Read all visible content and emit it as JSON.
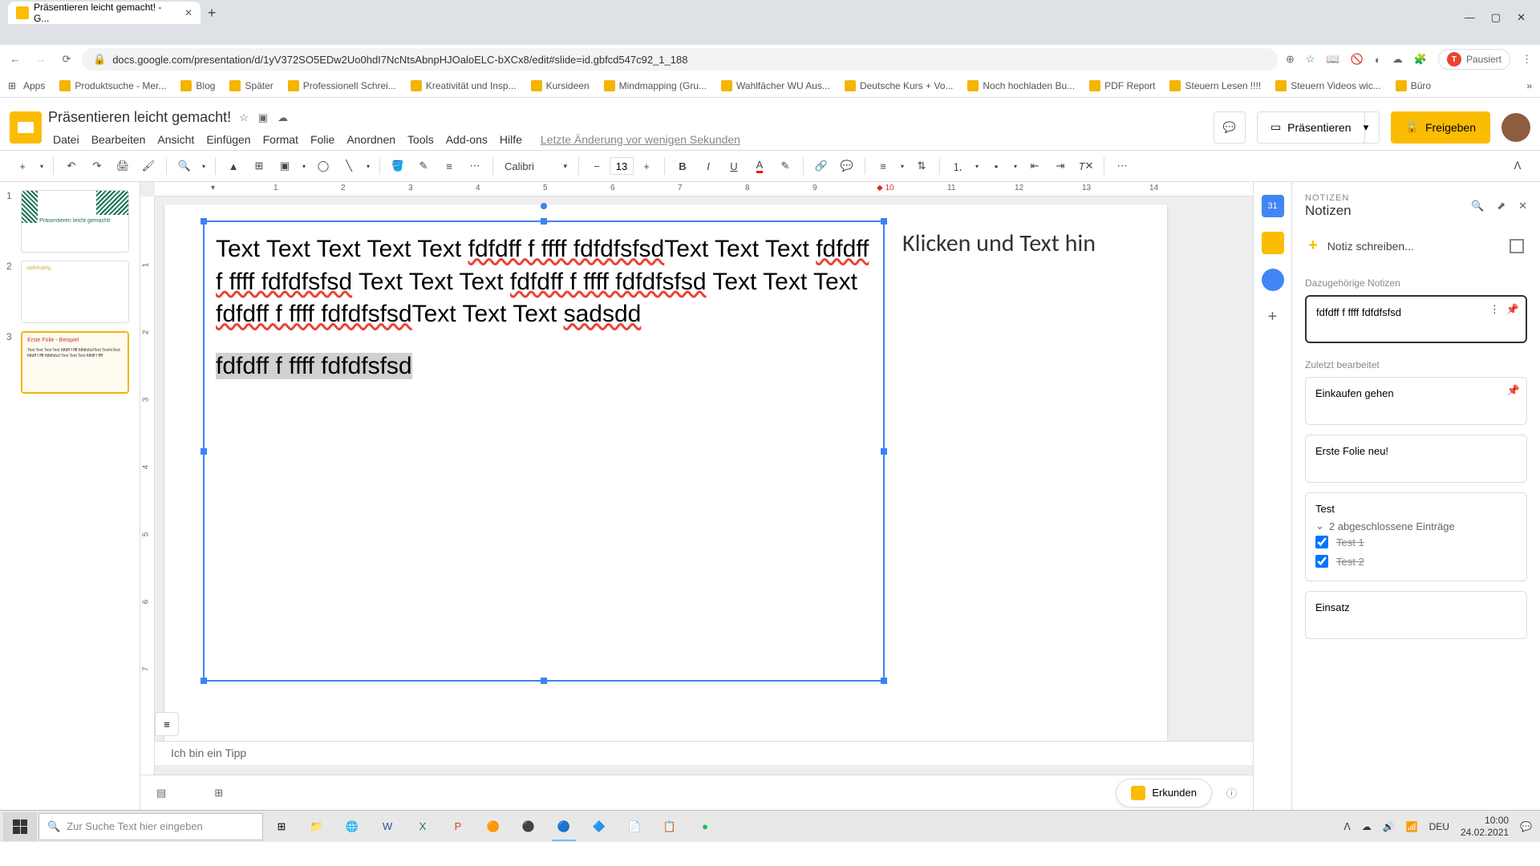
{
  "browser": {
    "tab_title": "Präsentieren leicht gemacht! - G...",
    "url": "docs.google.com/presentation/d/1yV372SO5EDw2Uo0hdI7NcNtsAbnpHJOaloELC-bXCx8/edit#slide=id.gbfcd547c92_1_188",
    "profile_label": "Pausiert"
  },
  "bookmarks": [
    "Apps",
    "Produktsuche - Mer...",
    "Blog",
    "Später",
    "Professionell Schrei...",
    "Kreativität und Insp...",
    "Kursideen",
    "Mindmapping (Gru...",
    "Wahlfächer WU Aus...",
    "Deutsche Kurs + Vo...",
    "Noch hochladen Bu...",
    "PDF Report",
    "Steuern Lesen !!!!",
    "Steuern Videos wic...",
    "Büro"
  ],
  "doc": {
    "title": "Präsentieren leicht gemacht!",
    "menus": [
      "Datei",
      "Bearbeiten",
      "Ansicht",
      "Einfügen",
      "Format",
      "Folie",
      "Anordnen",
      "Tools",
      "Add-ons",
      "Hilfe"
    ],
    "last_edit": "Letzte Änderung vor wenigen Sekunden",
    "present": "Präsentieren",
    "share": "Freigeben"
  },
  "toolbar": {
    "font": "Calibri",
    "font_size": "13"
  },
  "thumbnails": [
    {
      "num": "1",
      "title": "Präsentieren leicht gemacht!"
    },
    {
      "num": "2",
      "title": "sdlfkfhdkflg"
    },
    {
      "num": "3",
      "title": "Erste Folie - Beispiel",
      "body": "Text Text Text Text fdfdff f ffff fdfdfsfsdText Text\\nText fdfdff f ffff fdfdfsfsd Text Text Text fdfdff f ffff"
    }
  ],
  "slide": {
    "body_plain": "Text Text Text Text Text ",
    "err1": "fdfdff f ffff fdfdfsfsd",
    "mid1": "Text Text Text ",
    "err2": "fdfdff f ffff fdfdfsfsd",
    "mid2": " Text Text Text ",
    "err3": "fdfdff f ffff fdfdfsfsd",
    "mid3": " Text Text Text ",
    "err4": "fdfdff f ffff fdfdfsfsd",
    "mid4": "Text Text Text ",
    "err5": "sadsdd",
    "highlighted": "fdfdff f ffff fdfdfsfsd",
    "placeholder2": "Klicken und Text hin"
  },
  "speaker_notes": "Ich bin ein Tipp",
  "explore": "Erkunden",
  "keep": {
    "label_small": "NOTIZEN",
    "title": "Notizen",
    "new_note": "Notiz schreiben...",
    "section_related": "Dazugehörige Notizen",
    "note_related": "fdfdff f ffff fdfdfsfsd",
    "section_recent": "Zuletzt bearbeitet",
    "note_shopping": "Einkaufen gehen",
    "note_first": "Erste Folie neu!",
    "note_test_title": "Test",
    "note_test_completed": "2 abgeschlossene Einträge",
    "test_items": [
      "Test 1",
      "Test 2"
    ],
    "note_einsatz": "Einsatz"
  },
  "taskbar": {
    "search_placeholder": "Zur Suche Text hier eingeben",
    "lang": "DEU",
    "time": "10:00",
    "date": "24.02.2021"
  }
}
